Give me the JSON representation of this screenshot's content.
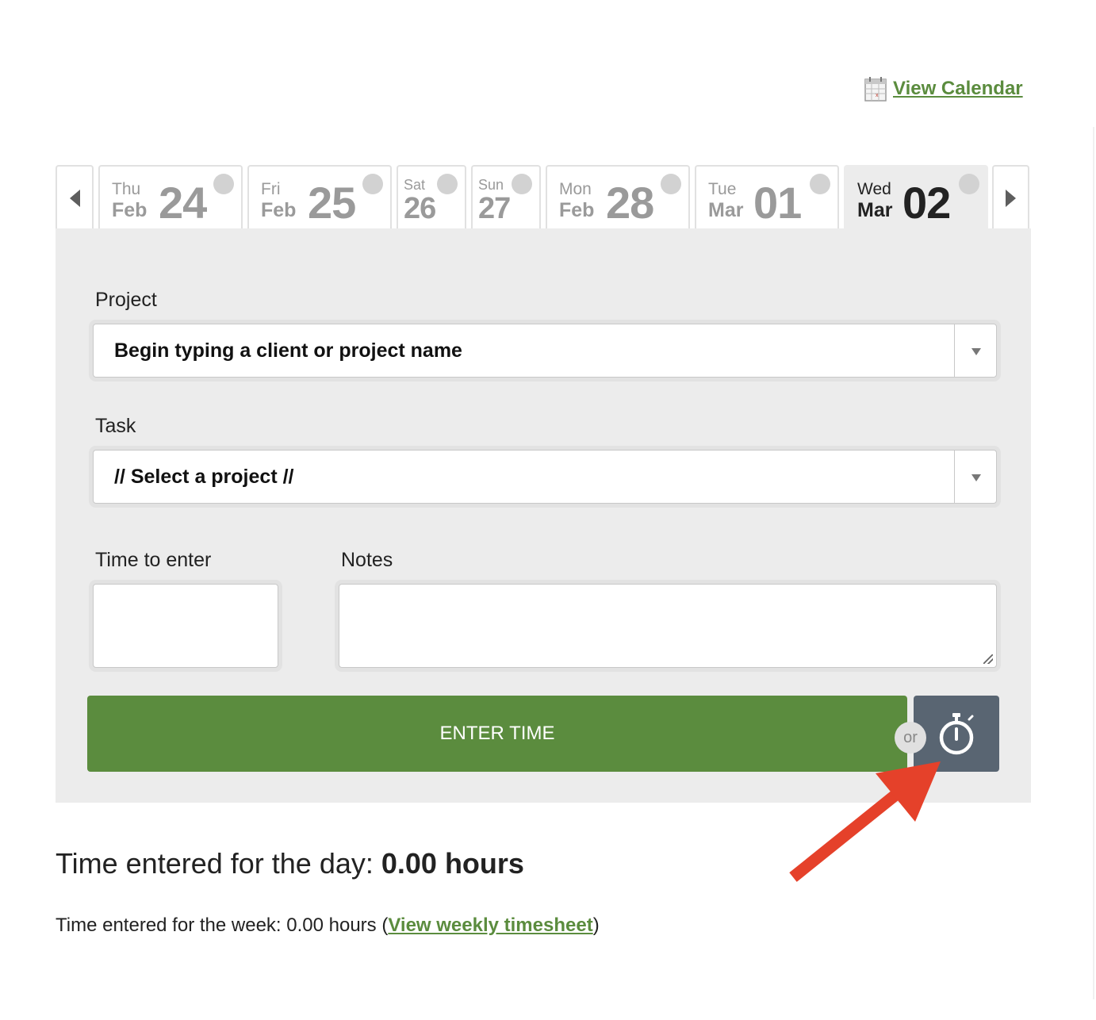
{
  "header": {
    "view_calendar_label": "View Calendar"
  },
  "days": [
    {
      "dow": "Thu",
      "month": "Feb",
      "day": "24"
    },
    {
      "dow": "Fri",
      "month": "Feb",
      "day": "25"
    },
    {
      "dow": "Sat",
      "day": "26"
    },
    {
      "dow": "Sun",
      "day": "27"
    },
    {
      "dow": "Mon",
      "month": "Feb",
      "day": "28"
    },
    {
      "dow": "Tue",
      "month": "Mar",
      "day": "01"
    },
    {
      "dow": "Wed",
      "month": "Mar",
      "day": "02",
      "selected": true
    }
  ],
  "form": {
    "project_label": "Project",
    "project_value": "Begin typing a client or project name",
    "task_label": "Task",
    "task_value": "// Select a project //",
    "time_label": "Time to enter",
    "time_value": "",
    "notes_label": "Notes",
    "notes_value": "",
    "enter_button": "ENTER TIME",
    "or_label": "or",
    "timer_icon": "stopwatch-icon"
  },
  "totals": {
    "day_prefix": "Time entered for the day: ",
    "day_value": "0.00 hours",
    "week_prefix": "Time entered for the week: 0.00 hours (",
    "week_link": "View weekly timesheet",
    "week_suffix": ")"
  },
  "colors": {
    "accent_green": "#5b8c3e",
    "timer_button": "#596572",
    "panel_bg": "#ececec",
    "annotation_arrow": "#e5412a"
  }
}
